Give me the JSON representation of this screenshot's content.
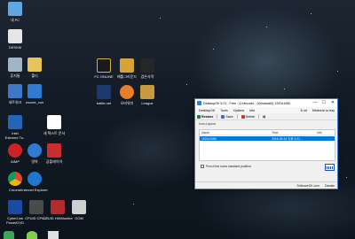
{
  "desktop": {
    "icons": [
      {
        "label": "내 PC",
        "color": "#5fa7e0"
      },
      {
        "label": "DESKM",
        "color": "#e6e6e6"
      },
      {
        "label": "휴지통",
        "color": "#9fb5c9"
      },
      {
        "label": "폴더",
        "color": "#e8c25a"
      },
      {
        "label": "네트워크",
        "color": "#3d78c8"
      },
      {
        "label": "zscore_cus",
        "color": "#2f7bd1"
      },
      {
        "label": "FC ONLINE",
        "color": "#1a1a1a"
      },
      {
        "label": "배틀그라운드",
        "color": "#d9a237"
      },
      {
        "label": "검은사막",
        "color": "#262626"
      },
      {
        "label": "battle.net",
        "color": "#1b3b6f"
      },
      {
        "label": "오버워치",
        "color": "#e97e2a"
      },
      {
        "label": "League",
        "color": "#c79a3f"
      },
      {
        "label": "Intel\nExtreme Tu..",
        "color": "#2365b7"
      },
      {
        "label": "새 텍스트 문서",
        "color": "#ffffff"
      },
      {
        "label": "AIMP",
        "color": "#cc2424"
      },
      {
        "label": "알약",
        "color": "#2f7bd1"
      },
      {
        "label": "곰플레이어",
        "color": "#c92d2d"
      },
      {
        "label": "Chrome",
        "color": "#3aa657"
      },
      {
        "label": "Internet Explorer",
        "color": "#1c78d0"
      },
      {
        "label": "CyberLink PowerDVD",
        "color": "#1a4aa5"
      },
      {
        "label": "CPUID CPU-Z",
        "color": "#4b4b4b"
      },
      {
        "label": "CPUID HWMonitor",
        "color": "#b42b2b"
      },
      {
        "label": "GOM",
        "color": "#cfcfcf"
      }
    ]
  },
  "window": {
    "title": "DesktopOK 5.21 - Free - Q:Hecodio - (Window64) 1920x1080",
    "controls": {
      "minimize": "—",
      "maximize": "☐",
      "close": "✕"
    },
    "menu": [
      "DesktopOK",
      "Tools",
      "Options",
      "Info"
    ],
    "menu_right": [
      "E-xit",
      "Minimize to tray"
    ],
    "toolbar": {
      "restore": "Restore",
      "save": "Save",
      "delete": "Delete",
      "extra": "▤"
    },
    "tree_label": "Icon-Layout",
    "columns": [
      "Name",
      "Time",
      "Info"
    ],
    "rows": [
      {
        "name": "1920x1080",
        "time": "2018-05-14 오후 2:21 ...",
        "info": ""
      }
    ],
    "punch_label": "Punch the icons standard position.",
    "status": {
      "site": "SoftwareOK.com",
      "donate": "Donate"
    }
  }
}
